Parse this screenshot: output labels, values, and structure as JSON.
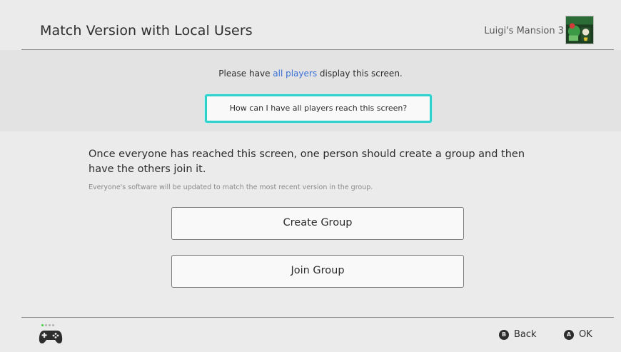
{
  "header": {
    "title": "Match Version with Local Users",
    "game_name": "Luigi's Mansion 3",
    "game_thumb_icon": "luigis-mansion-3-cover-icon"
  },
  "top_panel": {
    "instruction_before": "Please have ",
    "instruction_link": "all players",
    "instruction_after": " display this screen.",
    "help_button_label": "How can I have all players reach this screen?"
  },
  "main": {
    "body_text": "Once everyone has reached this screen, one person should create a group and then have the others join it.",
    "sub_text": "Everyone's software will be updated to match the most recent version in the group.",
    "create_group_label": "Create Group",
    "join_group_label": "Join Group"
  },
  "footer": {
    "controller_icon": "controller-icon",
    "player_indicator": "player-1",
    "back_key": "B",
    "back_label": "Back",
    "ok_key": "A",
    "ok_label": "OK"
  },
  "colors": {
    "accent_cyan": "#2fd1cd",
    "link_blue": "#3a6fd8",
    "player_green": "#3fd23c",
    "background": "#ebebeb"
  }
}
